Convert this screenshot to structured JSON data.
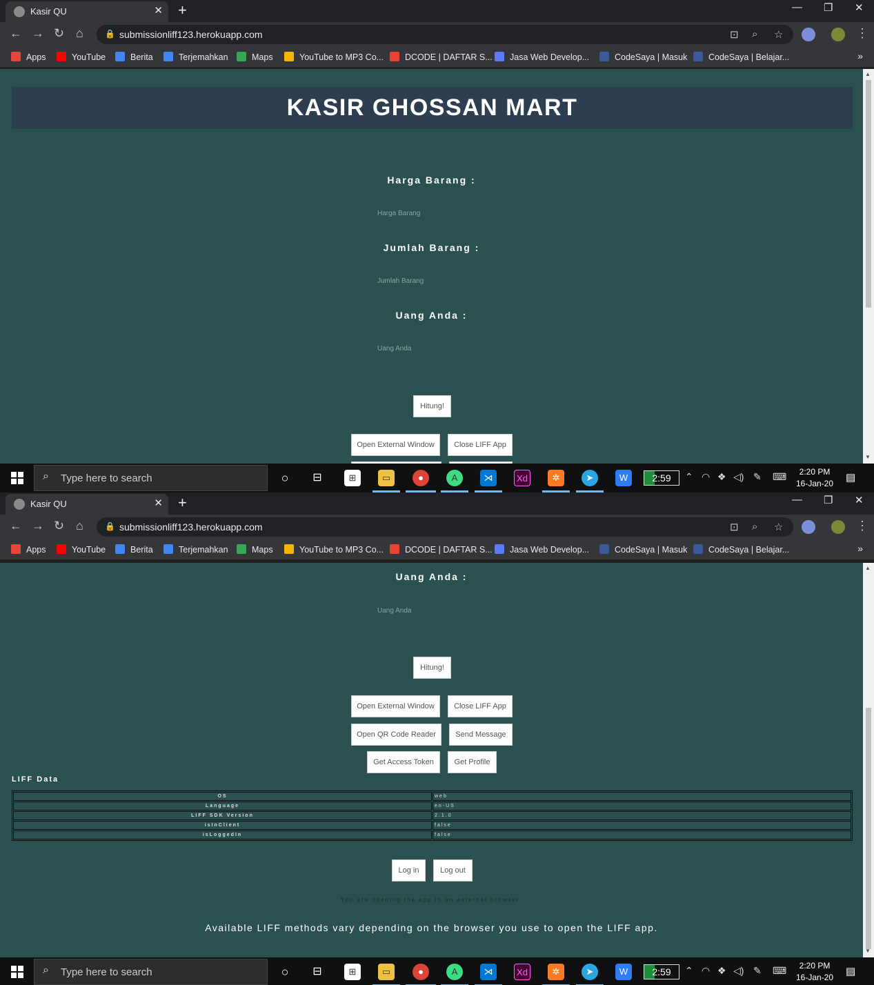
{
  "browser": {
    "tab_title": "Kasir QU",
    "url": "submissionliff123.herokuapp.com",
    "bookmarks": [
      {
        "label": "Apps",
        "color": "#e8453c"
      },
      {
        "label": "YouTube",
        "color": "#ff0000"
      },
      {
        "label": "Berita",
        "color": "#4285f4"
      },
      {
        "label": "Terjemahkan",
        "color": "#4285f4"
      },
      {
        "label": "Maps",
        "color": "#34a853"
      },
      {
        "label": "YouTube to MP3 Co...",
        "color": "#f4b400"
      },
      {
        "label": "DCODE | DAFTAR S...",
        "color": "#ea4335"
      },
      {
        "label": "Jasa Web Develop...",
        "color": "#5b7cfa"
      },
      {
        "label": "CodeSaya | Masuk",
        "color": "#3a5a9a"
      },
      {
        "label": "CodeSaya | Belajar...",
        "color": "#3a5a9a"
      }
    ],
    "more": "»"
  },
  "page": {
    "header": "KASIR GHOSSAN MART",
    "harga_label": "Harga Barang :",
    "harga_placeholder": "Harga Barang",
    "jumlah_label": "Jumlah Barang :",
    "jumlah_placeholder": "Jumlah Barang",
    "uang_label": "Uang Anda :",
    "uang_placeholder": "Uang Anda",
    "hitung": "Hitung!",
    "open_external": "Open External Window",
    "close_liff": "Close LIFF App",
    "open_qr": "Open QR Code Reader",
    "send_message": "Send Message",
    "get_token": "Get Access Token",
    "get_profile": "Get Profile",
    "liff_data_title": "LIFF Data",
    "liff_rows": [
      {
        "key": "OS",
        "value": "web"
      },
      {
        "key": "Language",
        "value": "en-US"
      },
      {
        "key": "LIFF SDK Version",
        "value": "2.1.0"
      },
      {
        "key": "isInClient",
        "value": "false"
      },
      {
        "key": "isLoggedIn",
        "value": "false"
      }
    ],
    "login": "Log in",
    "logout": "Log out",
    "external_note": "You are opening the app in an external browser.",
    "available_note": "Available LIFF methods vary depending on the browser you use to open the LIFF app."
  },
  "taskbar": {
    "search_placeholder": "Type here to search",
    "battery": "2:59",
    "time": "2:20 PM",
    "date": "16-Jan-20"
  },
  "colors": {
    "page_bg": "#2b5050",
    "header_bg": "#2c3e50"
  }
}
